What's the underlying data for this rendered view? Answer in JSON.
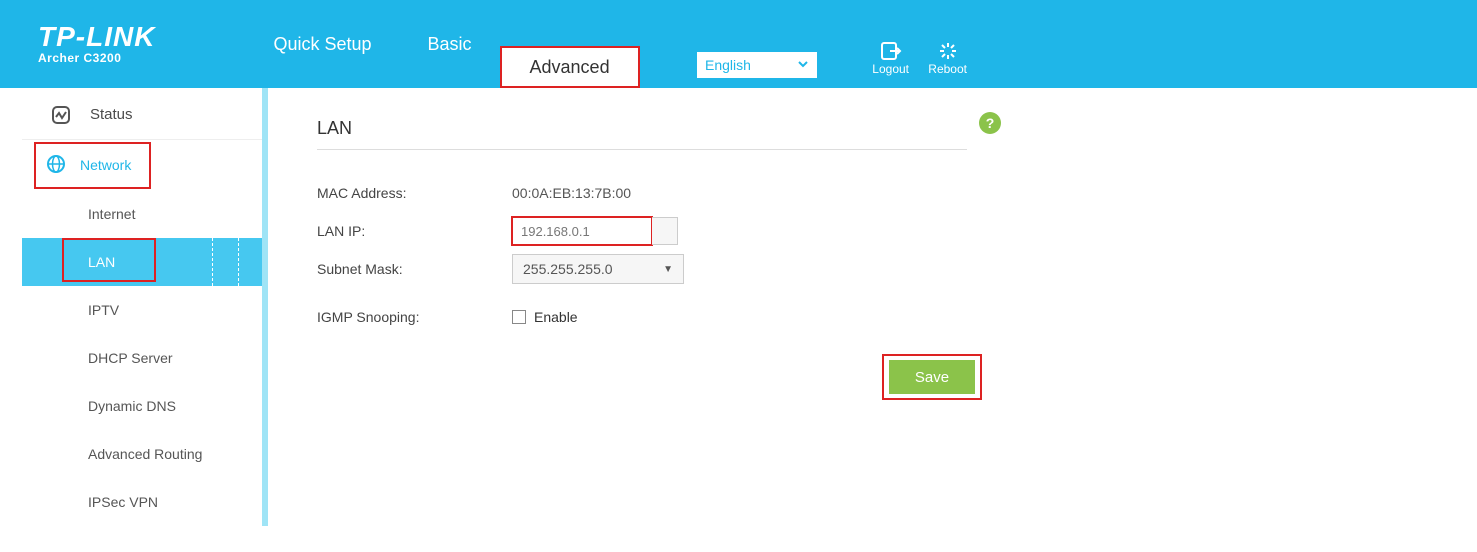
{
  "brand": {
    "name": "TP-LINK",
    "model": "Archer C3200"
  },
  "tabs": {
    "quick": "Quick Setup",
    "basic": "Basic",
    "advanced": "Advanced"
  },
  "language": "English",
  "header_actions": {
    "logout": "Logout",
    "reboot": "Reboot"
  },
  "sidebar": {
    "status": "Status",
    "network": "Network",
    "subs": {
      "internet": "Internet",
      "lan": "LAN",
      "iptv": "IPTV",
      "dhcp": "DHCP Server",
      "ddns": "Dynamic DNS",
      "routing": "Advanced Routing",
      "ipsec": "IPSec VPN"
    }
  },
  "panel": {
    "title": "LAN",
    "mac_label": "MAC Address:",
    "mac_value": "00:0A:EB:13:7B:00",
    "lanip_label": "LAN IP:",
    "lanip_value": "192.168.0.1",
    "subnet_label": "Subnet Mask:",
    "subnet_value": "255.255.255.0",
    "igmp_label": "IGMP Snooping:",
    "enable_label": "Enable",
    "save": "Save"
  }
}
